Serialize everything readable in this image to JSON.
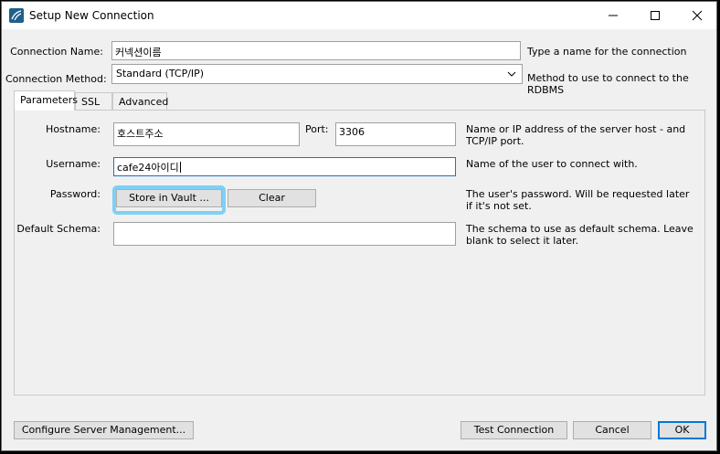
{
  "window": {
    "title": "Setup New Connection"
  },
  "connection": {
    "name_label": "Connection Name:",
    "name_value": "커넥션이름",
    "name_hint": "Type a name for the connection",
    "method_label": "Connection Method:",
    "method_value": "Standard (TCP/IP)",
    "method_hint": "Method to use to connect to the RDBMS"
  },
  "tabs": [
    {
      "label": "Parameters",
      "active": true
    },
    {
      "label": "SSL",
      "active": false
    },
    {
      "label": "Advanced",
      "active": false
    }
  ],
  "parameters": {
    "hostname_label": "Hostname:",
    "hostname_value": "호스트주소",
    "port_label": "Port:",
    "port_value": "3306",
    "host_hint": "Name or IP address of the server host - and TCP/IP port.",
    "username_label": "Username:",
    "username_value": "cafe24아이디",
    "username_hint": "Name of the user to connect with.",
    "password_label": "Password:",
    "store_vault_label": "Store in Vault ...",
    "clear_label": "Clear",
    "password_hint": "The user's password. Will be requested later if it's not set.",
    "schema_label": "Default Schema:",
    "schema_value": "",
    "schema_hint": "The schema to use as default schema. Leave blank to select it later."
  },
  "footer": {
    "configure_label": "Configure Server Management...",
    "test_label": "Test Connection",
    "cancel_label": "Cancel",
    "ok_label": "OK"
  },
  "colors": {
    "highlight": "#7fd0f5",
    "focus_border": "#1a73c8",
    "default_button_border": "#0078d7"
  },
  "icons": [
    "mysql-workbench-icon",
    "minimize-icon",
    "maximize-icon",
    "close-icon",
    "chevron-down-icon"
  ]
}
